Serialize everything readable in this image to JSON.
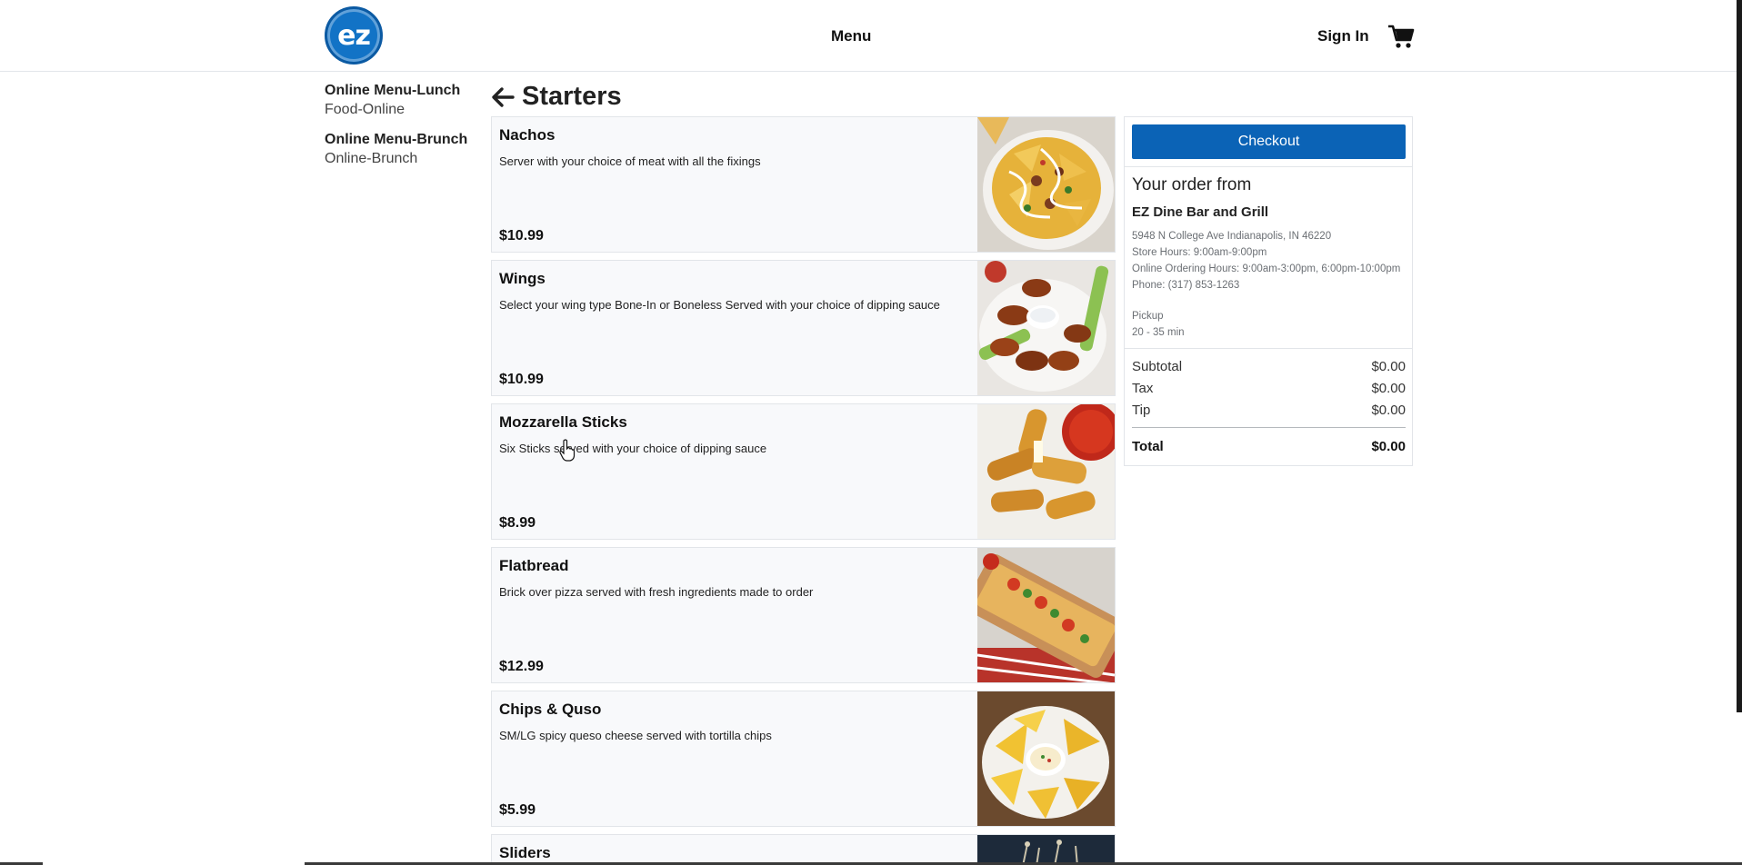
{
  "header": {
    "logo_text": "ez",
    "nav_label": "Menu",
    "sign_in_label": "Sign In",
    "cart_icon": "cart-icon"
  },
  "sidebar": {
    "groups": [
      {
        "title": "Online Menu-Lunch",
        "subtitle": "Food-Online"
      },
      {
        "title": "Online Menu-Brunch",
        "subtitle": "Online-Brunch"
      }
    ]
  },
  "section": {
    "title": "Starters",
    "back_icon": "arrow-left-icon"
  },
  "items": [
    {
      "name": "Nachos",
      "description": "Server with your choice of meat with all the fixings",
      "price": "$10.99"
    },
    {
      "name": "Wings",
      "description": "Select your wing type Bone-In or Boneless Served with your choice of dipping sauce",
      "price": "$10.99"
    },
    {
      "name": "Mozzarella Sticks",
      "description": "Six Sticks served with your choice of dipping sauce",
      "price": "$8.99"
    },
    {
      "name": "Flatbread",
      "description": "Brick over pizza served with fresh ingredients made to order",
      "price": "$12.99"
    },
    {
      "name": "Chips & Quso",
      "description": "SM/LG spicy queso cheese served with tortilla chips",
      "price": "$5.99"
    },
    {
      "name": "Sliders"
    }
  ],
  "order": {
    "checkout_label": "Checkout",
    "heading": "Your order from",
    "restaurant": "EZ Dine Bar and Grill",
    "address": "5948 N College Ave Indianapolis, IN 46220",
    "store_hours": "Store Hours: 9:00am-9:00pm",
    "online_hours": "Online Ordering Hours: 9:00am-3:00pm, 6:00pm-10:00pm",
    "phone": "Phone: (317) 853-1263",
    "method": "Pickup",
    "eta": "20 - 35 min",
    "subtotal_label": "Subtotal",
    "subtotal": "$0.00",
    "tax_label": "Tax",
    "tax": "$0.00",
    "tip_label": "Tip",
    "tip": "$0.00",
    "total_label": "Total",
    "total": "$0.00"
  },
  "colors": {
    "primary": "#0b63b6",
    "logo": "#1273c6",
    "card_bg": "#f8f9fb"
  }
}
